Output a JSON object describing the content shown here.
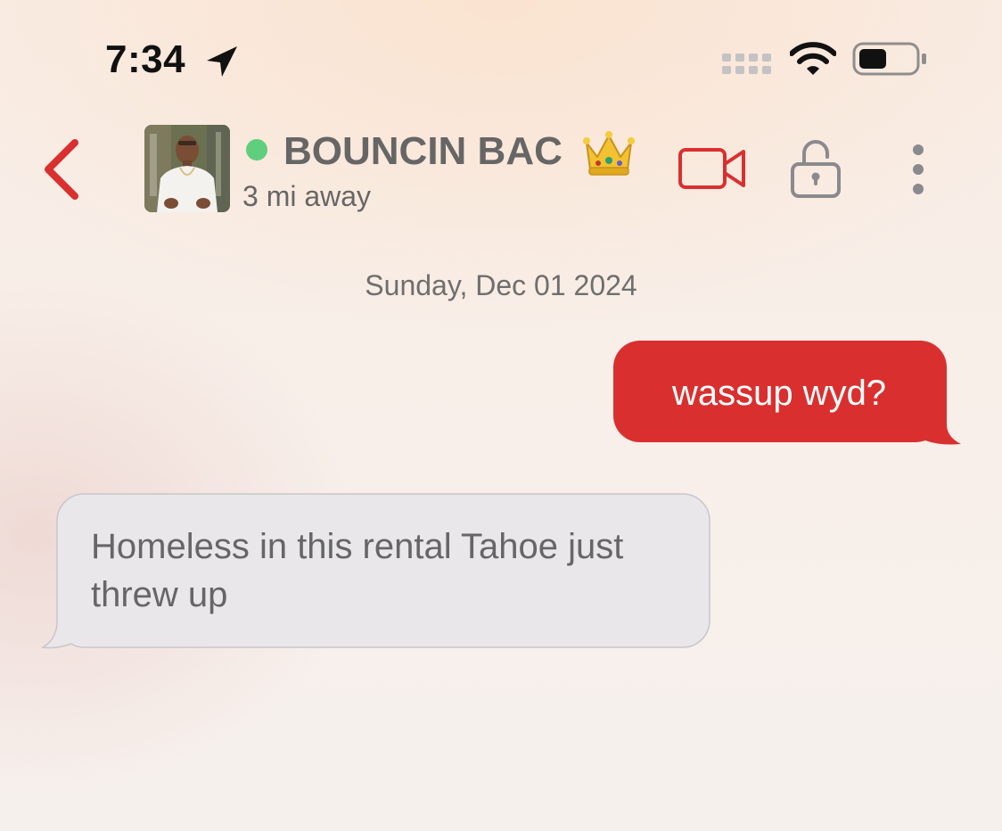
{
  "status_bar": {
    "time": "7:34",
    "icons": [
      "location-arrow-icon",
      "cellular-signal-icon",
      "wifi-icon",
      "battery-icon"
    ]
  },
  "header": {
    "contact_name": "BOUNCIN BAC",
    "contact_emoji": "crown-icon",
    "distance": "3 mi away",
    "online": true,
    "icons": [
      "chevron-left-icon",
      "video-camera-icon",
      "unlock-icon",
      "more-vertical-icon"
    ]
  },
  "conversation": {
    "date_label": "Sunday, Dec 01 2024",
    "messages": [
      {
        "direction": "sent",
        "text": "wassup wyd?"
      },
      {
        "direction": "received",
        "text": "Homeless in this rental Tahoe just threw up"
      }
    ]
  },
  "colors": {
    "accent": "#d9302f",
    "sent_bubble": "#d9302f",
    "received_bubble": "#e9e7ea",
    "online": "#5fcf7e",
    "icon_gray": "#8a8a8e"
  }
}
